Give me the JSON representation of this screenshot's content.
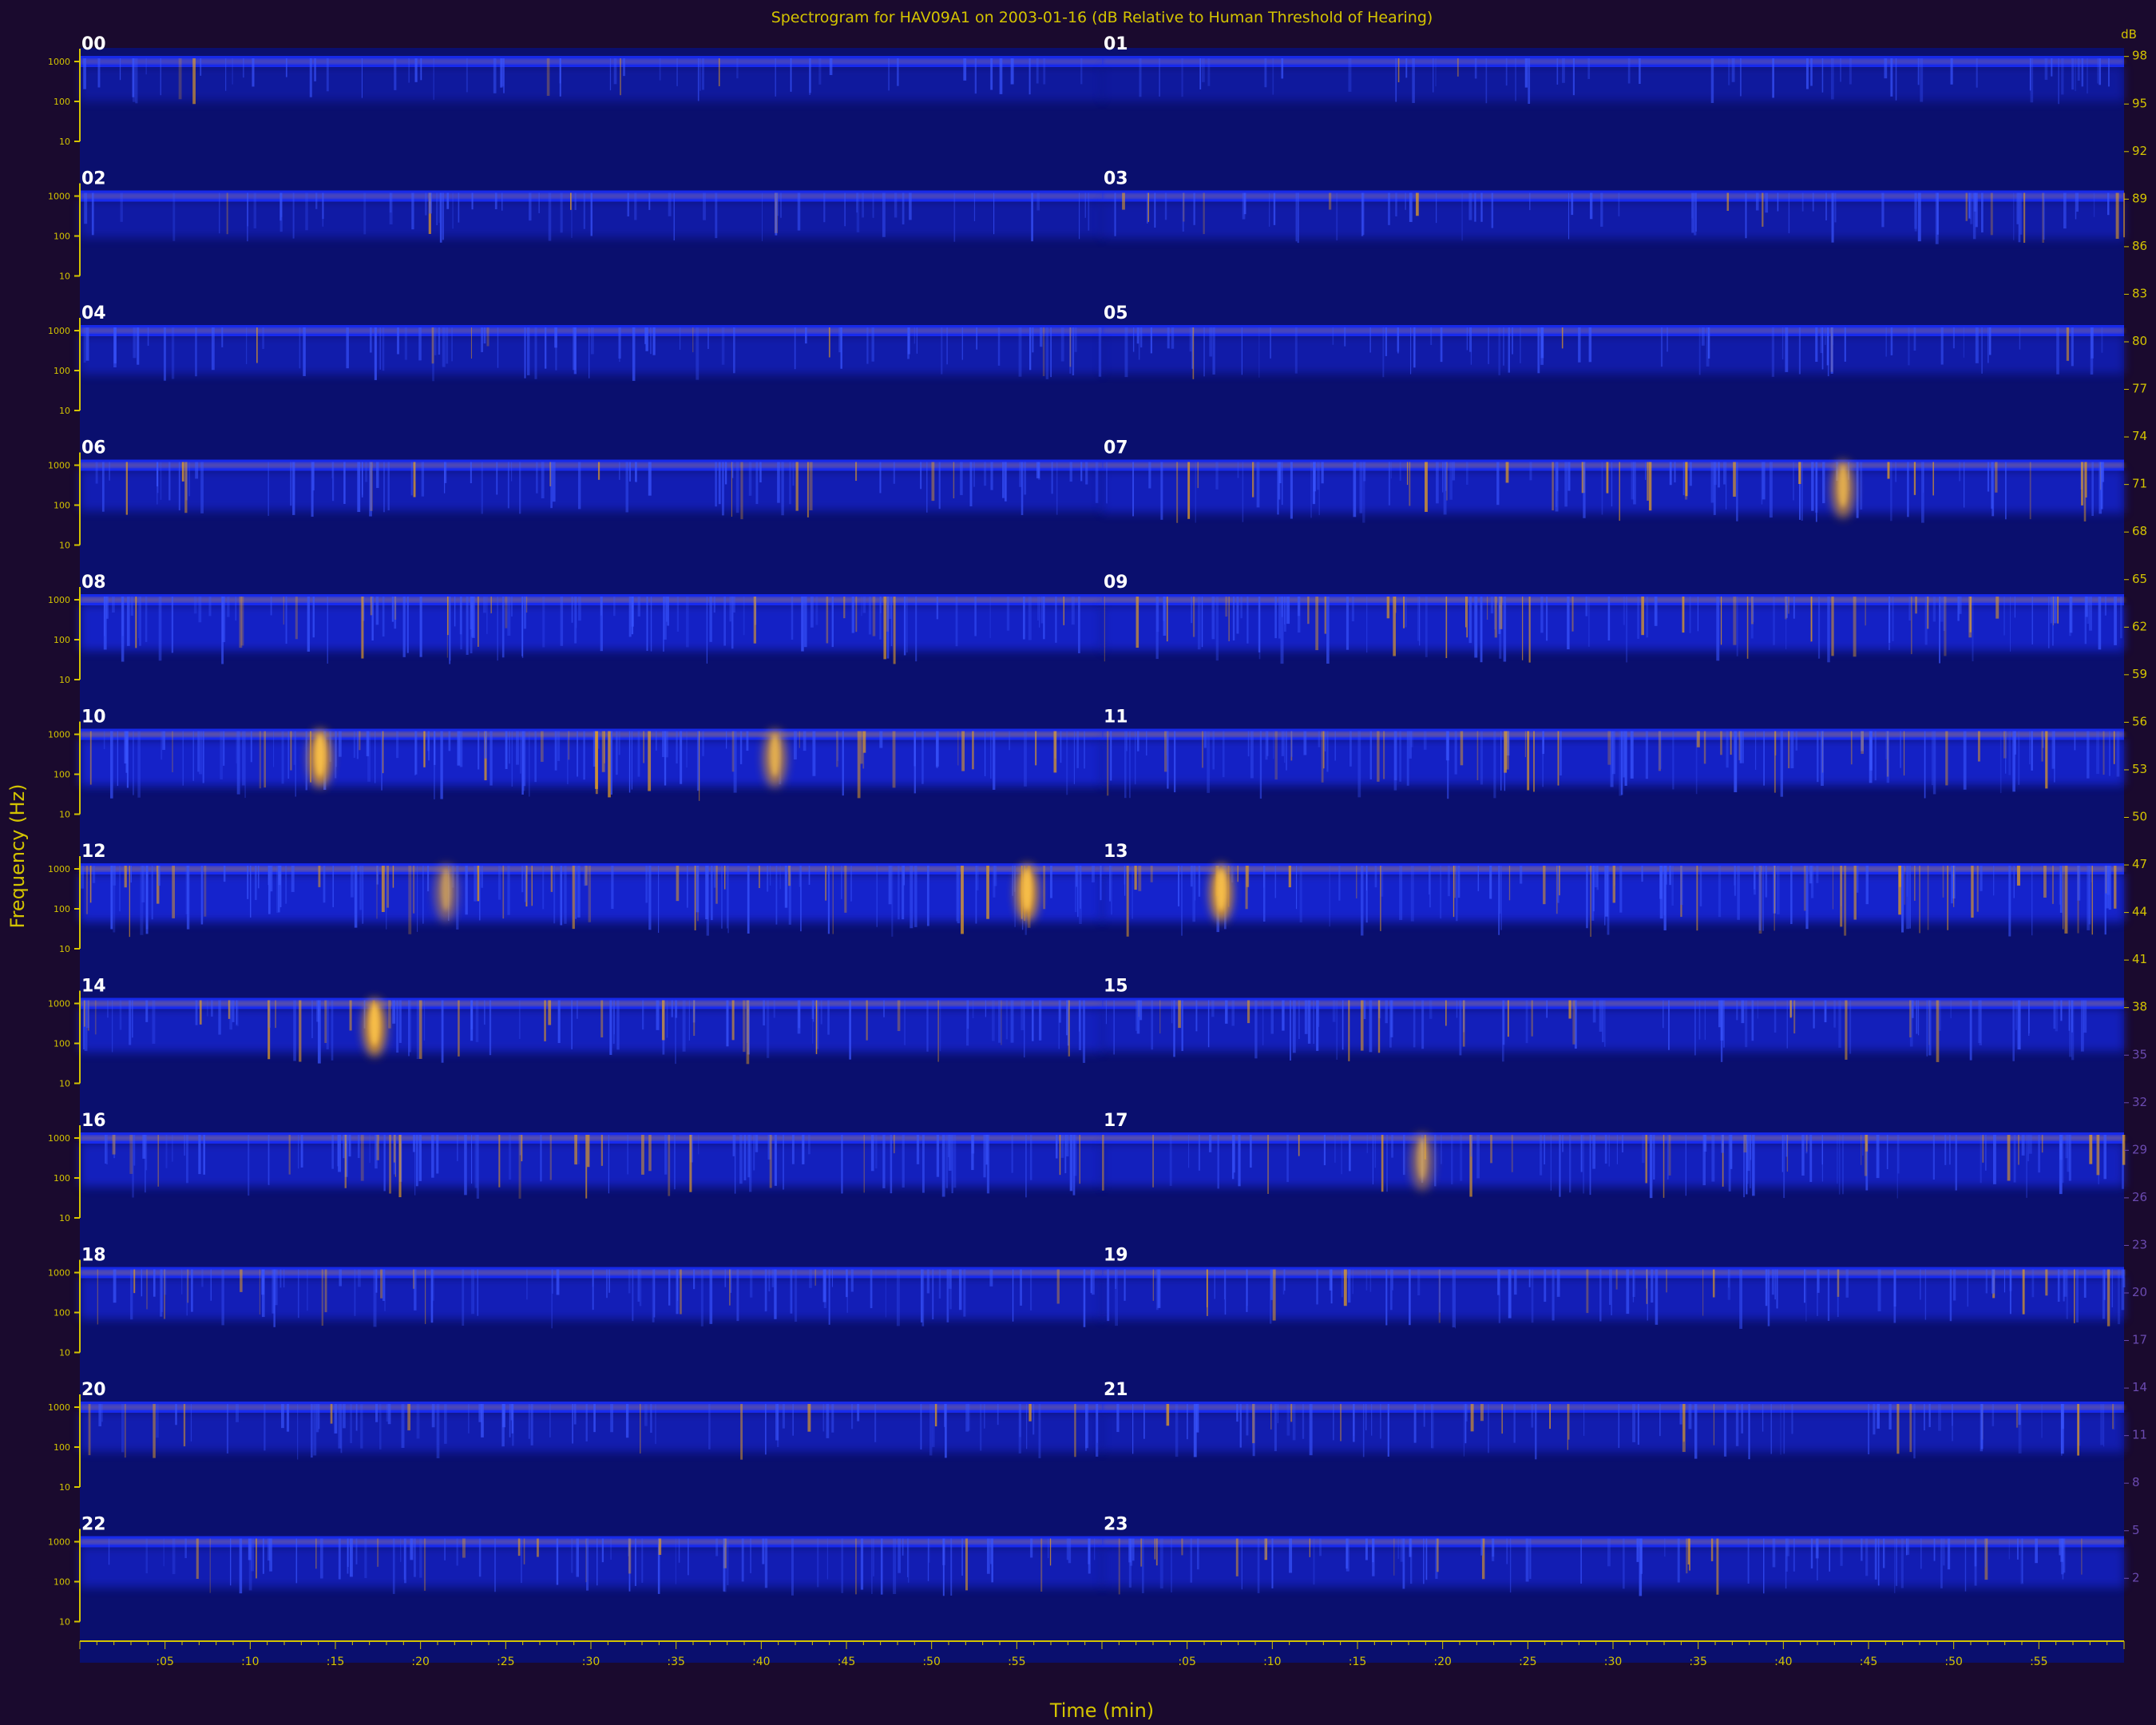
{
  "chart_data": {
    "type": "heatmap",
    "title": "Spectrogram for HAV09A1 on 2003-01-16 (dB Relative to Human Threshold of Hearing)",
    "xlabel": "Time (min)",
    "ylabel": "Frequency (Hz)",
    "row_labels": [
      "00",
      "01",
      "02",
      "03",
      "04",
      "05",
      "06",
      "07",
      "08",
      "09",
      "10",
      "11",
      "12",
      "13",
      "14",
      "15",
      "16",
      "17",
      "18",
      "19",
      "20",
      "21",
      "22",
      "23"
    ],
    "freq_tick_labels": [
      "1000",
      "100",
      "10"
    ],
    "time_tick_labels": [
      ":05",
      ":10",
      ":15",
      ":20",
      ":25",
      ":30",
      ":35",
      ":40",
      ":45",
      ":50",
      ":55"
    ],
    "colorbar_unit": "dB",
    "colorbar_ticks": [
      98,
      95,
      92,
      89,
      86,
      83,
      80,
      77,
      74,
      71,
      68,
      65,
      62,
      59,
      56,
      53,
      50,
      47,
      44,
      41,
      38,
      35,
      32,
      29,
      26,
      23,
      20,
      17,
      14,
      11,
      8,
      5,
      2
    ],
    "colorbar_range": [
      0,
      100
    ],
    "row_activity": [
      0.15,
      0.15,
      0.25,
      0.3,
      0.35,
      0.3,
      0.45,
      0.55,
      0.7,
      0.7,
      0.75,
      0.7,
      0.8,
      0.8,
      0.6,
      0.55,
      0.6,
      0.6,
      0.5,
      0.5,
      0.4,
      0.4,
      0.45,
      0.45
    ],
    "events": [
      {
        "row": "10",
        "minute": 14.1,
        "intensity": 1.0
      },
      {
        "row": "10",
        "minute": 40.8,
        "intensity": 0.8
      },
      {
        "row": "12",
        "minute": 55.6,
        "intensity": 1.0
      },
      {
        "row": "12",
        "minute": 21.5,
        "intensity": 0.6
      },
      {
        "row": "13",
        "minute": 7.0,
        "intensity": 1.0
      },
      {
        "row": "14",
        "minute": 17.3,
        "intensity": 1.0
      },
      {
        "row": "07",
        "minute": 43.5,
        "intensity": 0.8
      },
      {
        "row": "17",
        "minute": 18.8,
        "intensity": 0.6
      }
    ]
  },
  "colors": {
    "background": "#1a0a2e",
    "plot_bg": "#0a0f6e",
    "band": "#1a2fff",
    "hot": "#e8a020",
    "axis": "#d4c400",
    "row_label": "#ffffff"
  }
}
